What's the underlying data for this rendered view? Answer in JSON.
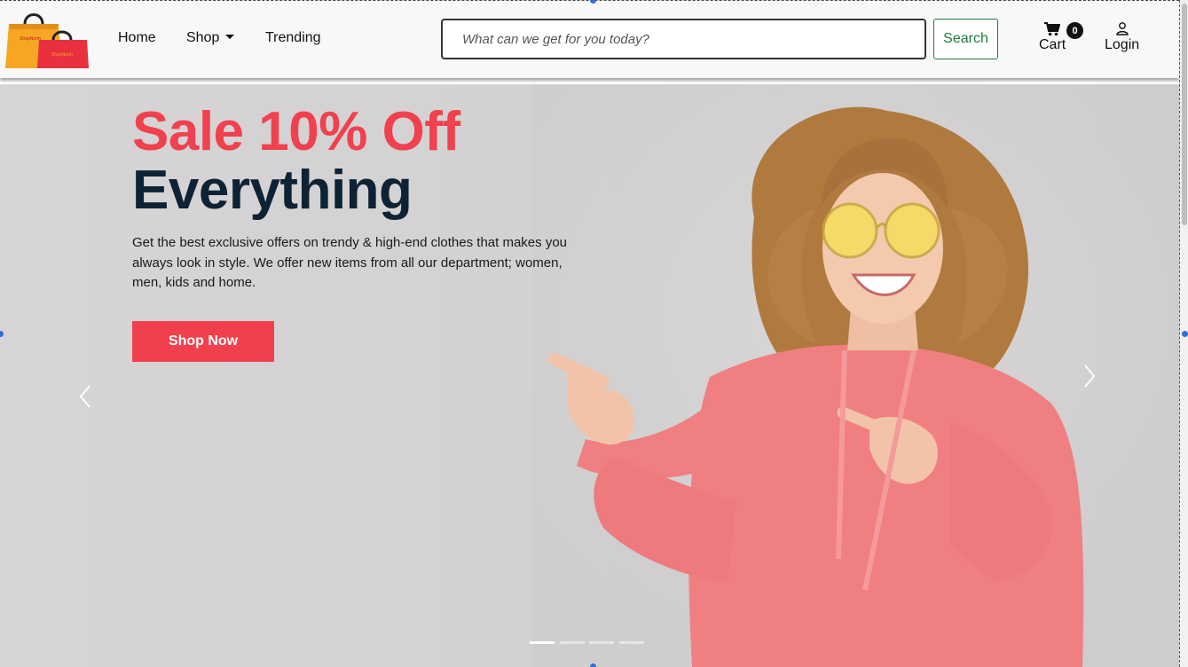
{
  "header": {
    "logo_text": "ShopNorm",
    "nav": [
      {
        "label": "Home"
      },
      {
        "label": "Shop"
      },
      {
        "label": "Trending"
      }
    ],
    "search": {
      "placeholder": "What can we get for you today?",
      "value": "",
      "button_label": "Search"
    },
    "cart": {
      "label": "Cart",
      "count": "0"
    },
    "login": {
      "label": "Login"
    }
  },
  "hero": {
    "title_line1": "Sale 10% Off",
    "title_line2": "Everything",
    "description": "Get the best exclusive offers on trendy & high-end clothes that makes you always look in style. We offer new items from all our department; women, men, kids and home.",
    "cta_label": "Shop Now",
    "slide_count": 4,
    "active_slide": 1
  },
  "colors": {
    "accent": "#f1404d",
    "title_dark": "#0e2235",
    "search_green": "#1f7a3a",
    "hero_bg": "#d4d2d3"
  },
  "icons": [
    "shopping-bags-logo",
    "cart-icon",
    "user-icon",
    "chevron-left-icon",
    "chevron-right-icon"
  ]
}
